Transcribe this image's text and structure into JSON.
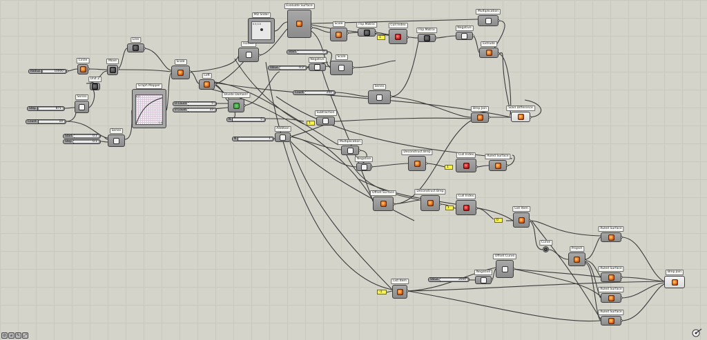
{
  "canvas": {
    "background": "#d5d4cb",
    "grid": "#c9c8bf",
    "wire": "#3a3a3a"
  },
  "components": [
    {
      "id": "circle",
      "label": "Circle",
      "icon": "circle-icon"
    },
    {
      "id": "move",
      "label": "Move",
      "icon": "move-icon"
    },
    {
      "id": "line",
      "label": "Line",
      "icon": "line-icon"
    },
    {
      "id": "unitz",
      "label": "Unit Z",
      "icon": "vector-icon"
    },
    {
      "id": "series1",
      "label": "Series",
      "icon": "series-icon"
    },
    {
      "id": "series2",
      "label": "Series",
      "icon": "series-icon"
    },
    {
      "id": "scale",
      "label": "Scale",
      "icon": "scale-icon"
    },
    {
      "id": "loft",
      "label": "Loft",
      "icon": "loft-icon"
    },
    {
      "id": "evalsurf",
      "label": "Evaluate Surface",
      "icon": "evaluate-surface-icon"
    },
    {
      "id": "isotrim",
      "label": "Isotrim",
      "icon": "isotrim-icon"
    },
    {
      "id": "divdomain",
      "label": "Divide Domain²",
      "icon": "divide-domain-icon"
    },
    {
      "id": "scale2",
      "label": "Scale",
      "icon": "scale-icon"
    },
    {
      "id": "flipmatrix1",
      "label": "Flip Matrix",
      "icon": "flip-matrix-icon"
    },
    {
      "id": "cullindex1",
      "label": "Cull Index",
      "icon": "cull-index-icon"
    },
    {
      "id": "flipmatrix2",
      "label": "Flip Matrix",
      "icon": "flip-matrix-icon"
    },
    {
      "id": "mult1",
      "label": "Multiplication",
      "icon": "multiplication-icon"
    },
    {
      "id": "negative1",
      "label": "Negative",
      "icon": "negative-icon"
    },
    {
      "id": "extrude",
      "label": "Extrude",
      "icon": "extrude-icon"
    },
    {
      "id": "negative2",
      "label": "Negative",
      "icon": "negative-icon"
    },
    {
      "id": "scale3",
      "label": "Scale",
      "icon": "scale-icon"
    },
    {
      "id": "series3",
      "label": "Series",
      "icon": "series-icon"
    },
    {
      "id": "subtraction",
      "label": "Subtraction",
      "icon": "subtraction-icon"
    },
    {
      "id": "brepjoin1",
      "label": "Brep Join",
      "icon": "brep-join-icon"
    },
    {
      "id": "soliddiff",
      "label": "Solid Difference",
      "icon": "solid-difference-icon"
    },
    {
      "id": "addition",
      "label": "Addition",
      "icon": "addition-icon"
    },
    {
      "id": "mult2",
      "label": "Multiplication",
      "icon": "multiplication-icon"
    },
    {
      "id": "negative3",
      "label": "Negative",
      "icon": "negative-icon"
    },
    {
      "id": "decbrep1",
      "label": "Deconstruct Brep",
      "icon": "deconstruct-brep-icon"
    },
    {
      "id": "cullindex2",
      "label": "Cull Index",
      "icon": "cull-index-icon"
    },
    {
      "id": "ruled1",
      "label": "Ruled Surface",
      "icon": "ruled-surface-icon"
    },
    {
      "id": "offsetsurf",
      "label": "Offset Surface",
      "icon": "offset-surface-icon"
    },
    {
      "id": "decbrep2",
      "label": "Deconstruct Brep",
      "icon": "deconstruct-brep-icon"
    },
    {
      "id": "cullindex3",
      "label": "Cull Index",
      "icon": "cull-index-icon"
    },
    {
      "id": "listitem1",
      "label": "List Item",
      "icon": "list-item-icon"
    },
    {
      "id": "curve",
      "label": "Curve",
      "icon": "curve-icon"
    },
    {
      "id": "project",
      "label": "Project",
      "icon": "project-icon"
    },
    {
      "id": "ruled2",
      "label": "Ruled Surface",
      "icon": "ruled-surface-icon"
    },
    {
      "id": "ruled3",
      "label": "Ruled Surface",
      "icon": "ruled-surface-icon"
    },
    {
      "id": "ruled4",
      "label": "Ruled Surface",
      "icon": "ruled-surface-icon"
    },
    {
      "id": "ruled5",
      "label": "Ruled Surface",
      "icon": "ruled-surface-icon"
    },
    {
      "id": "offsetcurve",
      "label": "Offset Curve",
      "icon": "offset-curve-icon"
    },
    {
      "id": "negative4",
      "label": "Negative",
      "icon": "negative-icon"
    },
    {
      "id": "listitem2",
      "label": "List Item",
      "icon": "list-item-icon"
    },
    {
      "id": "brepjoin2",
      "label": "Brep Join",
      "icon": "brep-join-icon"
    }
  ],
  "special": {
    "graph_mapper": {
      "label": "Graph Mapper",
      "r0": "0.0",
      "r1": "1.0"
    },
    "md_slider": {
      "label": "MD Slider",
      "value": "0.5,0.5"
    }
  },
  "sliders": [
    {
      "id": "radius",
      "label": "Radius",
      "value": "10000"
    },
    {
      "id": "step",
      "label": "Step",
      "value": "871"
    },
    {
      "id": "count",
      "label": "Count",
      "value": "10"
    },
    {
      "id": "start",
      "label": "Start",
      "value": "0.1"
    },
    {
      "id": "step2",
      "label": "Step",
      "value": "0.1"
    },
    {
      "id": "ucount",
      "label": "U Count",
      "value": "5"
    },
    {
      "id": "vcount",
      "label": "V Count",
      "value": "33"
    },
    {
      "id": "n5",
      "label": "N",
      "value": "5"
    },
    {
      "id": "n1",
      "label": "N",
      "value": "1"
    },
    {
      "id": "startval",
      "label": "Start",
      "value": "0"
    },
    {
      "id": "value",
      "label": "Value",
      "value": "0.2"
    },
    {
      "id": "count2",
      "label": "Count",
      "value": "200"
    },
    {
      "id": "value2",
      "label": "Value",
      "value": "2000"
    }
  ],
  "panels": [
    {
      "id": "p1",
      "text": "1"
    },
    {
      "id": "p2",
      "text": "1"
    },
    {
      "id": "p3",
      "text": "1"
    },
    {
      "id": "p4",
      "text": "1"
    },
    {
      "id": "p5",
      "text": "0"
    },
    {
      "id": "p6",
      "text": "-1"
    }
  ],
  "toolbar": [
    "⊘",
    "⌀",
    "✎",
    "⤢"
  ]
}
